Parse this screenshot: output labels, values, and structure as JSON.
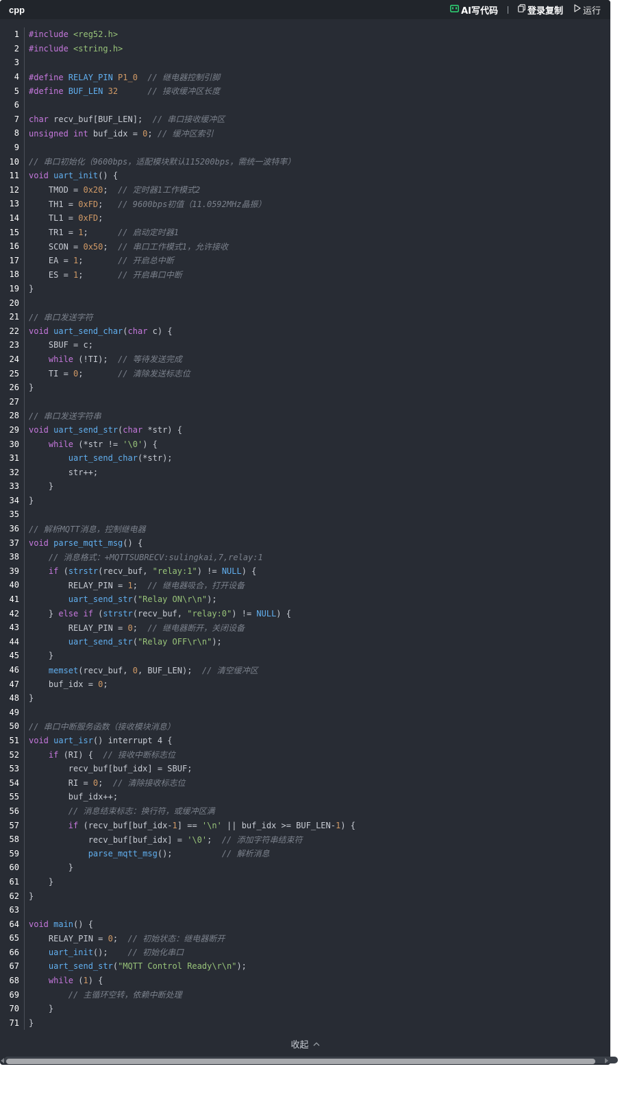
{
  "header": {
    "language": "cpp",
    "ai_label": "AI写代码",
    "copy_label": "登录复制",
    "run_label": "运行"
  },
  "collapse_label": "收起",
  "code": [
    {
      "n": "1",
      "t": [
        [
          "kw",
          "#include "
        ],
        [
          "str",
          "<reg52.h>"
        ]
      ]
    },
    {
      "n": "2",
      "t": [
        [
          "kw",
          "#include "
        ],
        [
          "str",
          "<string.h>"
        ]
      ]
    },
    {
      "n": "3",
      "t": []
    },
    {
      "n": "4",
      "t": [
        [
          "kw",
          "#define "
        ],
        [
          "fn",
          "RELAY_PIN "
        ],
        [
          "num",
          "P1_0"
        ],
        [
          "pl",
          "  "
        ],
        [
          "com",
          "// 继电器控制引脚"
        ]
      ]
    },
    {
      "n": "5",
      "t": [
        [
          "kw",
          "#define "
        ],
        [
          "fn",
          "BUF_LEN "
        ],
        [
          "num",
          "32"
        ],
        [
          "pl",
          "      "
        ],
        [
          "com",
          "// 接收缓冲区长度"
        ]
      ]
    },
    {
      "n": "6",
      "t": []
    },
    {
      "n": "7",
      "t": [
        [
          "kw",
          "char "
        ],
        [
          "pl",
          "recv_buf[BUF_LEN];  "
        ],
        [
          "com",
          "// 串口接收缓冲区"
        ]
      ]
    },
    {
      "n": "8",
      "t": [
        [
          "kw",
          "unsigned int "
        ],
        [
          "pl",
          "buf_idx = "
        ],
        [
          "num",
          "0"
        ],
        [
          "pl",
          "; "
        ],
        [
          "com",
          "// 缓冲区索引"
        ]
      ]
    },
    {
      "n": "9",
      "t": []
    },
    {
      "n": "10",
      "t": [
        [
          "com",
          "// 串口初始化（9600bps，适配模块默认115200bps，需统一波特率）"
        ]
      ]
    },
    {
      "n": "11",
      "t": [
        [
          "kw",
          "void "
        ],
        [
          "fn",
          "uart_init"
        ],
        [
          "pl",
          "() {"
        ]
      ]
    },
    {
      "n": "12",
      "t": [
        [
          "pl",
          "    TMOD = "
        ],
        [
          "num",
          "0x20"
        ],
        [
          "pl",
          ";  "
        ],
        [
          "com",
          "// 定时器1工作模式2"
        ]
      ]
    },
    {
      "n": "13",
      "t": [
        [
          "pl",
          "    TH1 = "
        ],
        [
          "num",
          "0xFD"
        ],
        [
          "pl",
          ";   "
        ],
        [
          "com",
          "// 9600bps初值（11.0592MHz晶振）"
        ]
      ]
    },
    {
      "n": "14",
      "t": [
        [
          "pl",
          "    TL1 = "
        ],
        [
          "num",
          "0xFD"
        ],
        [
          "pl",
          ";"
        ]
      ]
    },
    {
      "n": "15",
      "t": [
        [
          "pl",
          "    TR1 = "
        ],
        [
          "num",
          "1"
        ],
        [
          "pl",
          ";      "
        ],
        [
          "com",
          "// 启动定时器1"
        ]
      ]
    },
    {
      "n": "16",
      "t": [
        [
          "pl",
          "    SCON = "
        ],
        [
          "num",
          "0x50"
        ],
        [
          "pl",
          ";  "
        ],
        [
          "com",
          "// 串口工作模式1，允许接收"
        ]
      ]
    },
    {
      "n": "17",
      "t": [
        [
          "pl",
          "    EA = "
        ],
        [
          "num",
          "1"
        ],
        [
          "pl",
          ";       "
        ],
        [
          "com",
          "// 开启总中断"
        ]
      ]
    },
    {
      "n": "18",
      "t": [
        [
          "pl",
          "    ES = "
        ],
        [
          "num",
          "1"
        ],
        [
          "pl",
          ";       "
        ],
        [
          "com",
          "// 开启串口中断"
        ]
      ]
    },
    {
      "n": "19",
      "t": [
        [
          "pl",
          "}"
        ]
      ]
    },
    {
      "n": "20",
      "t": []
    },
    {
      "n": "21",
      "t": [
        [
          "com",
          "// 串口发送字符"
        ]
      ]
    },
    {
      "n": "22",
      "t": [
        [
          "kw",
          "void "
        ],
        [
          "fn",
          "uart_send_char"
        ],
        [
          "pl",
          "("
        ],
        [
          "kw",
          "char "
        ],
        [
          "pl",
          "c) {"
        ]
      ]
    },
    {
      "n": "23",
      "t": [
        [
          "pl",
          "    SBUF = c;"
        ]
      ]
    },
    {
      "n": "24",
      "t": [
        [
          "kw",
          "    while "
        ],
        [
          "pl",
          "(!TI);  "
        ],
        [
          "com",
          "// 等待发送完成"
        ]
      ]
    },
    {
      "n": "25",
      "t": [
        [
          "pl",
          "    TI = "
        ],
        [
          "num",
          "0"
        ],
        [
          "pl",
          ";       "
        ],
        [
          "com",
          "// 清除发送标志位"
        ]
      ]
    },
    {
      "n": "26",
      "t": [
        [
          "pl",
          "}"
        ]
      ]
    },
    {
      "n": "27",
      "t": []
    },
    {
      "n": "28",
      "t": [
        [
          "com",
          "// 串口发送字符串"
        ]
      ]
    },
    {
      "n": "29",
      "t": [
        [
          "kw",
          "void "
        ],
        [
          "fn",
          "uart_send_str"
        ],
        [
          "pl",
          "("
        ],
        [
          "kw",
          "char "
        ],
        [
          "pl",
          "*str) {"
        ]
      ]
    },
    {
      "n": "30",
      "t": [
        [
          "kw",
          "    while "
        ],
        [
          "pl",
          "(*str != "
        ],
        [
          "str",
          "'\\0'"
        ],
        [
          "pl",
          ") {"
        ]
      ]
    },
    {
      "n": "31",
      "t": [
        [
          "fn",
          "        uart_send_char"
        ],
        [
          "pl",
          "(*str);"
        ]
      ]
    },
    {
      "n": "32",
      "t": [
        [
          "pl",
          "        str++;"
        ]
      ]
    },
    {
      "n": "33",
      "t": [
        [
          "pl",
          "    }"
        ]
      ]
    },
    {
      "n": "34",
      "t": [
        [
          "pl",
          "}"
        ]
      ]
    },
    {
      "n": "35",
      "t": []
    },
    {
      "n": "36",
      "t": [
        [
          "com",
          "// 解析MQTT消息，控制继电器"
        ]
      ]
    },
    {
      "n": "37",
      "t": [
        [
          "kw",
          "void "
        ],
        [
          "fn",
          "parse_mqtt_msg"
        ],
        [
          "pl",
          "() {"
        ]
      ]
    },
    {
      "n": "38",
      "t": [
        [
          "com",
          "    // 消息格式：+MQTTSUBRECV:sulingkai,7,relay:1"
        ]
      ]
    },
    {
      "n": "39",
      "t": [
        [
          "kw",
          "    if "
        ],
        [
          "pl",
          "("
        ],
        [
          "fn",
          "strstr"
        ],
        [
          "pl",
          "(recv_buf, "
        ],
        [
          "str",
          "\"relay:1\""
        ],
        [
          "pl",
          ") != "
        ],
        [
          "fn",
          "NULL"
        ],
        [
          "pl",
          ") {"
        ]
      ]
    },
    {
      "n": "40",
      "t": [
        [
          "pl",
          "        RELAY_PIN = "
        ],
        [
          "num",
          "1"
        ],
        [
          "pl",
          ";  "
        ],
        [
          "com",
          "// 继电器吸合，打开设备"
        ]
      ]
    },
    {
      "n": "41",
      "t": [
        [
          "fn",
          "        uart_send_str"
        ],
        [
          "pl",
          "("
        ],
        [
          "str",
          "\"Relay ON\\r\\n\""
        ],
        [
          "pl",
          ");"
        ]
      ]
    },
    {
      "n": "42",
      "t": [
        [
          "pl",
          "    } "
        ],
        [
          "kw",
          "else if "
        ],
        [
          "pl",
          "("
        ],
        [
          "fn",
          "strstr"
        ],
        [
          "pl",
          "(recv_buf, "
        ],
        [
          "str",
          "\"relay:0\""
        ],
        [
          "pl",
          ") != "
        ],
        [
          "fn",
          "NULL"
        ],
        [
          "pl",
          ") {"
        ]
      ]
    },
    {
      "n": "43",
      "t": [
        [
          "pl",
          "        RELAY_PIN = "
        ],
        [
          "num",
          "0"
        ],
        [
          "pl",
          ";  "
        ],
        [
          "com",
          "// 继电器断开，关闭设备"
        ]
      ]
    },
    {
      "n": "44",
      "t": [
        [
          "fn",
          "        uart_send_str"
        ],
        [
          "pl",
          "("
        ],
        [
          "str",
          "\"Relay OFF\\r\\n\""
        ],
        [
          "pl",
          ");"
        ]
      ]
    },
    {
      "n": "45",
      "t": [
        [
          "pl",
          "    }"
        ]
      ]
    },
    {
      "n": "46",
      "t": [
        [
          "fn",
          "    memset"
        ],
        [
          "pl",
          "(recv_buf, "
        ],
        [
          "num",
          "0"
        ],
        [
          "pl",
          ", BUF_LEN);  "
        ],
        [
          "com",
          "// 清空缓冲区"
        ]
      ]
    },
    {
      "n": "47",
      "t": [
        [
          "pl",
          "    buf_idx = "
        ],
        [
          "num",
          "0"
        ],
        [
          "pl",
          ";"
        ]
      ]
    },
    {
      "n": "48",
      "t": [
        [
          "pl",
          "}"
        ]
      ]
    },
    {
      "n": "49",
      "t": []
    },
    {
      "n": "50",
      "t": [
        [
          "com",
          "// 串口中断服务函数（接收模块消息）"
        ]
      ]
    },
    {
      "n": "51",
      "t": [
        [
          "kw",
          "void "
        ],
        [
          "fn",
          "uart_isr"
        ],
        [
          "pl",
          "() interrupt 4 {"
        ]
      ]
    },
    {
      "n": "52",
      "t": [
        [
          "kw",
          "    if "
        ],
        [
          "pl",
          "(RI) {  "
        ],
        [
          "com",
          "// 接收中断标志位"
        ]
      ]
    },
    {
      "n": "53",
      "t": [
        [
          "pl",
          "        recv_buf[buf_idx] = SBUF;"
        ]
      ]
    },
    {
      "n": "54",
      "t": [
        [
          "pl",
          "        RI = "
        ],
        [
          "num",
          "0"
        ],
        [
          "pl",
          ";  "
        ],
        [
          "com",
          "// 清除接收标志位"
        ]
      ]
    },
    {
      "n": "55",
      "t": [
        [
          "pl",
          "        buf_idx++;"
        ]
      ]
    },
    {
      "n": "56",
      "t": [
        [
          "com",
          "        // 消息结束标志：换行符，或缓冲区满"
        ]
      ]
    },
    {
      "n": "57",
      "t": [
        [
          "kw",
          "        if "
        ],
        [
          "pl",
          "(recv_buf[buf_idx-"
        ],
        [
          "num",
          "1"
        ],
        [
          "pl",
          "] == "
        ],
        [
          "str",
          "'\\n'"
        ],
        [
          "pl",
          " || buf_idx >= BUF_LEN-"
        ],
        [
          "num",
          "1"
        ],
        [
          "pl",
          ") {"
        ]
      ]
    },
    {
      "n": "58",
      "t": [
        [
          "pl",
          "            recv_buf[buf_idx] = "
        ],
        [
          "str",
          "'\\0'"
        ],
        [
          "pl",
          ";  "
        ],
        [
          "com",
          "// 添加字符串结束符"
        ]
      ]
    },
    {
      "n": "59",
      "t": [
        [
          "fn",
          "            parse_mqtt_msg"
        ],
        [
          "pl",
          "();          "
        ],
        [
          "com",
          "// 解析消息"
        ]
      ]
    },
    {
      "n": "60",
      "t": [
        [
          "pl",
          "        }"
        ]
      ]
    },
    {
      "n": "61",
      "t": [
        [
          "pl",
          "    }"
        ]
      ]
    },
    {
      "n": "62",
      "t": [
        [
          "pl",
          "}"
        ]
      ]
    },
    {
      "n": "63",
      "t": []
    },
    {
      "n": "64",
      "t": [
        [
          "kw",
          "void "
        ],
        [
          "fn",
          "main"
        ],
        [
          "pl",
          "() {"
        ]
      ]
    },
    {
      "n": "65",
      "t": [
        [
          "pl",
          "    RELAY_PIN = "
        ],
        [
          "num",
          "0"
        ],
        [
          "pl",
          ";  "
        ],
        [
          "com",
          "// 初始状态：继电器断开"
        ]
      ]
    },
    {
      "n": "66",
      "t": [
        [
          "fn",
          "    uart_init"
        ],
        [
          "pl",
          "();    "
        ],
        [
          "com",
          "// 初始化串口"
        ]
      ]
    },
    {
      "n": "67",
      "t": [
        [
          "fn",
          "    uart_send_str"
        ],
        [
          "pl",
          "("
        ],
        [
          "str",
          "\"MQTT Control Ready\\r\\n\""
        ],
        [
          "pl",
          ");"
        ]
      ]
    },
    {
      "n": "68",
      "t": [
        [
          "kw",
          "    while "
        ],
        [
          "pl",
          "("
        ],
        [
          "num",
          "1"
        ],
        [
          "pl",
          ") {"
        ]
      ]
    },
    {
      "n": "69",
      "t": [
        [
          "com",
          "        // 主循环空转，依赖中断处理"
        ]
      ]
    },
    {
      "n": "70",
      "t": [
        [
          "pl",
          "    }"
        ]
      ]
    },
    {
      "n": "71",
      "t": [
        [
          "pl",
          "}"
        ]
      ]
    }
  ]
}
